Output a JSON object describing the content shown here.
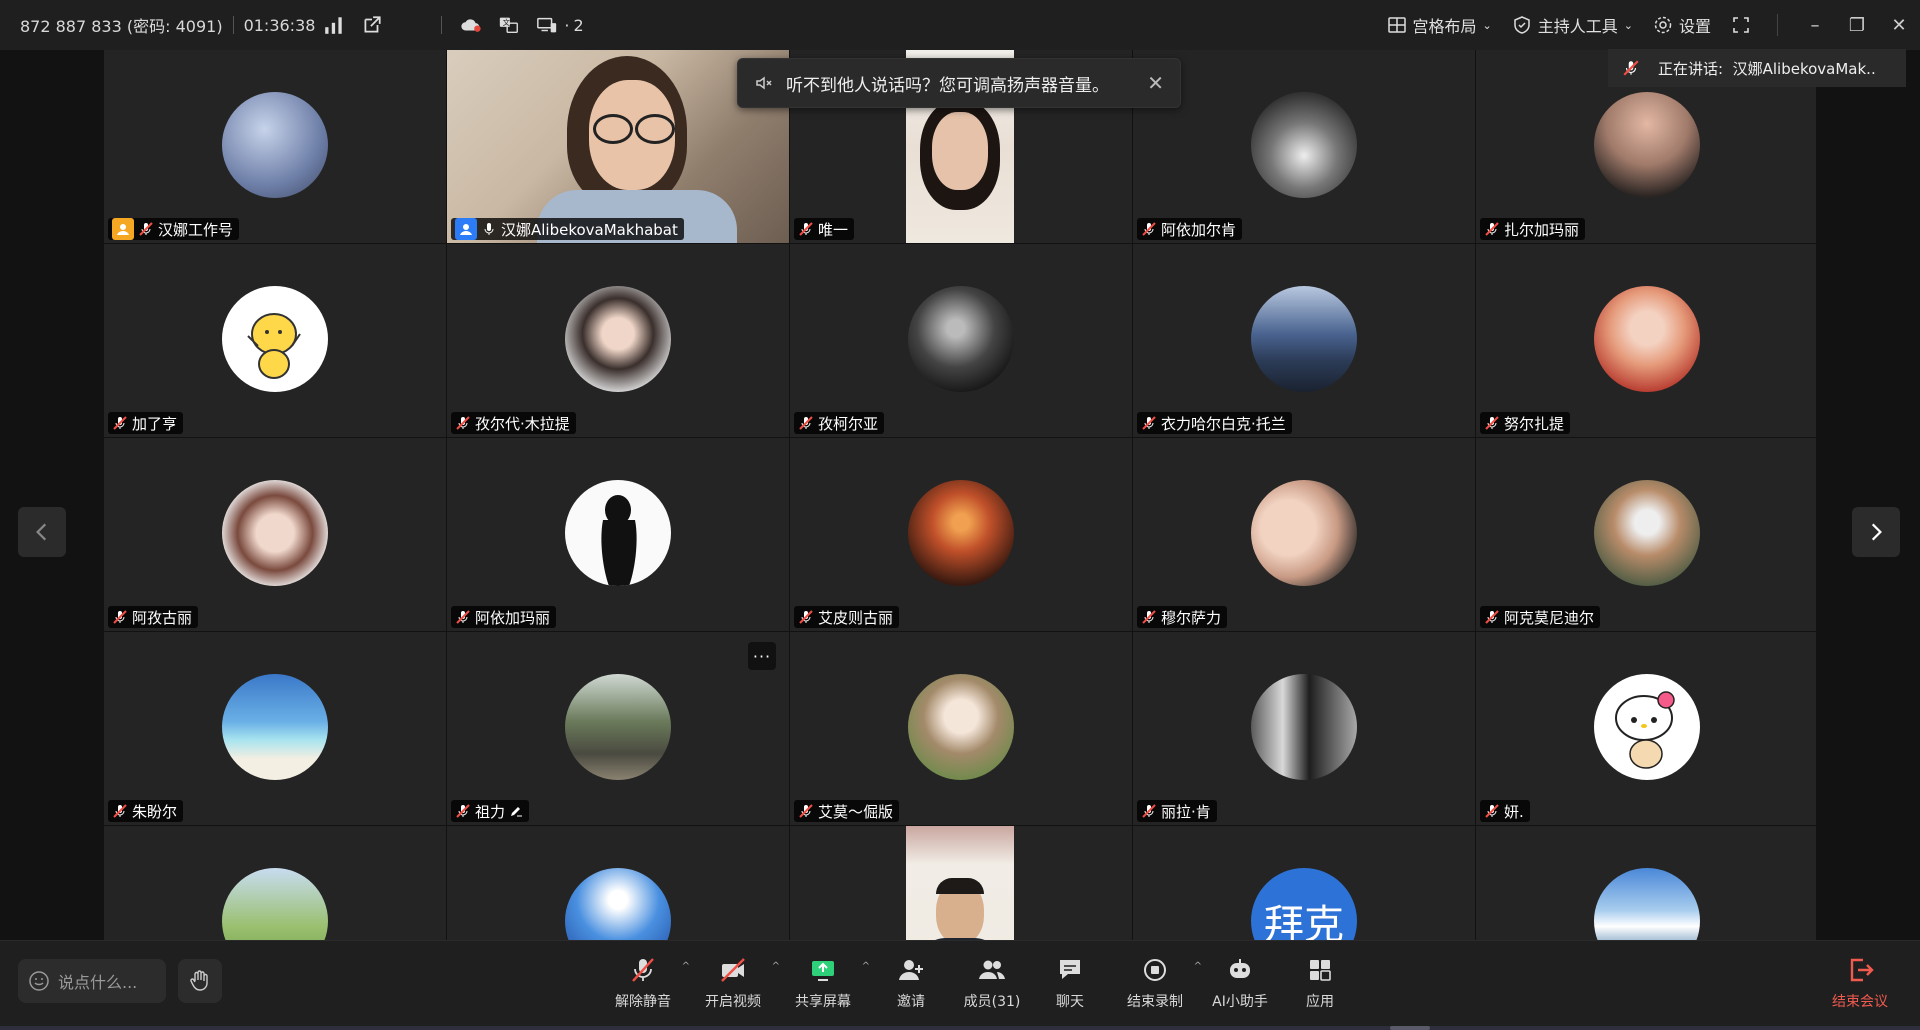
{
  "topbar": {
    "meeting_info": "872 887 833 (密码: 4091)",
    "elapsed_time": "01:36:38",
    "devices_count": "2",
    "layout_label": "宫格布局",
    "host_tools_label": "主持人工具",
    "settings_label": "设置"
  },
  "toast": {
    "message": "听不到他人说话吗？您可调高扬声器音量。"
  },
  "speaking": {
    "label": "正在讲话:",
    "name": "汉娜AlibekovaMak.."
  },
  "participants": [
    {
      "name": "汉娜工作号"
    },
    {
      "name": "汉娜AlibekovaMakhabat"
    },
    {
      "name": "唯一"
    },
    {
      "name": "阿依加尔肯"
    },
    {
      "name": "扎尔加玛丽"
    },
    {
      "name": "加了亨"
    },
    {
      "name": "孜尔代·木拉提"
    },
    {
      "name": "孜柯尔亚"
    },
    {
      "name": "衣力哈尔白克·托兰"
    },
    {
      "name": "努尔扎提"
    },
    {
      "name": "阿孜古丽"
    },
    {
      "name": "阿依加玛丽"
    },
    {
      "name": "艾皮则古丽"
    },
    {
      "name": "穆尔萨力"
    },
    {
      "name": "阿克莫尼迪尔"
    },
    {
      "name": "朱盼尔"
    },
    {
      "name": "祖力"
    },
    {
      "name": "艾莫～倔版"
    },
    {
      "name": "丽拉·肯"
    },
    {
      "name": "妍."
    },
    {
      "name": ""
    },
    {
      "name": ""
    },
    {
      "name": ""
    },
    {
      "name": "拜克"
    },
    {
      "name": ""
    }
  ],
  "more_button": "···",
  "bottombar": {
    "say_placeholder": "说点什么...",
    "unmute": "解除静音",
    "start_video": "开启视频",
    "share_screen": "共享屏幕",
    "invite": "邀请",
    "members": "成员(31)",
    "chat": "聊天",
    "stop_recording": "结束录制",
    "ai_assistant": "AI小助手",
    "apps": "应用",
    "end_meeting": "结束会议"
  },
  "colors": {
    "active_border": "#2fd07a",
    "end_meeting": "#f05a4f",
    "host_badge": "#f5a623",
    "cohost_badge": "#2b7cf6"
  }
}
